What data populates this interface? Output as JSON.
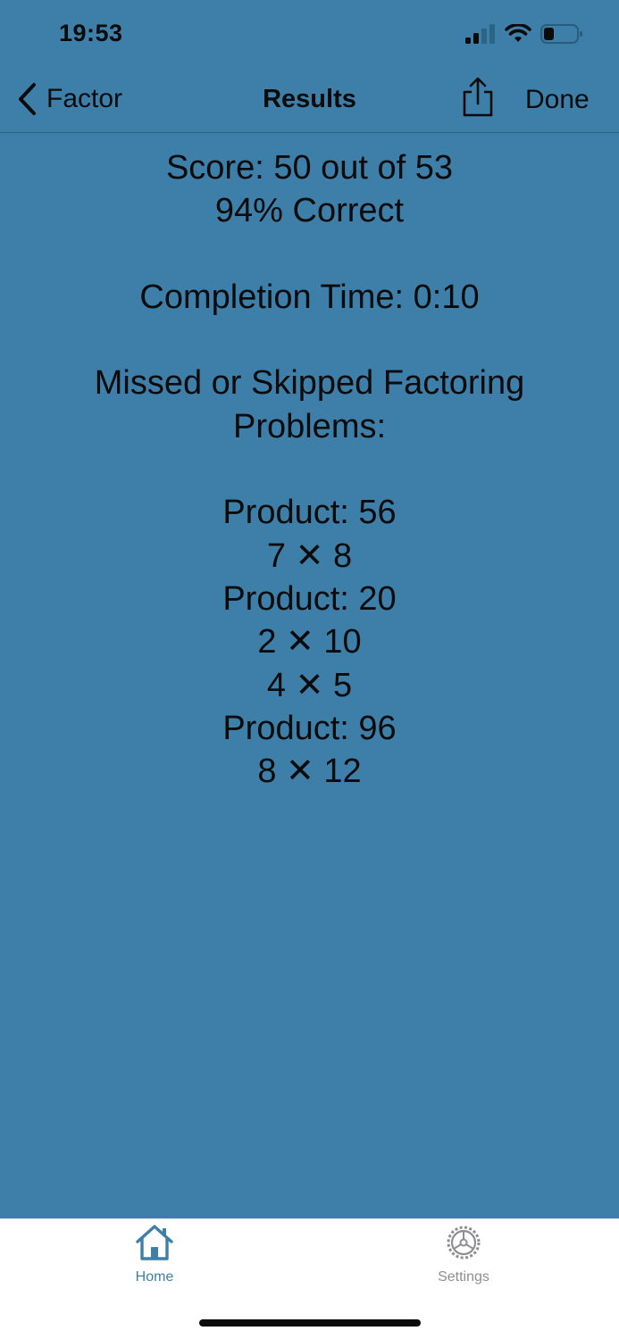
{
  "status_bar": {
    "time": "19:53"
  },
  "nav": {
    "back_label": "Factor",
    "title": "Results",
    "done_label": "Done"
  },
  "results": {
    "score": "Score: 50 out of 53",
    "percent": "94% Correct",
    "completion_time": "Completion Time: 0:10",
    "missed_heading_line1": "Missed or Skipped Factoring",
    "missed_heading_line2": "Problems:",
    "problems": [
      {
        "product": "Product: 56",
        "factors": [
          "7 ✕ 8"
        ]
      },
      {
        "product": "Product: 20",
        "factors": [
          "2 ✕ 10",
          "4 ✕ 5"
        ]
      },
      {
        "product": "Product: 96",
        "factors": [
          "8 ✕ 12"
        ]
      }
    ]
  },
  "tab_bar": {
    "home_label": "Home",
    "settings_label": "Settings",
    "active_color": "#3d7fa8",
    "inactive_color": "#8e8e93"
  },
  "colors": {
    "background": "#3d7fa8",
    "text": "#0b0b0b"
  }
}
